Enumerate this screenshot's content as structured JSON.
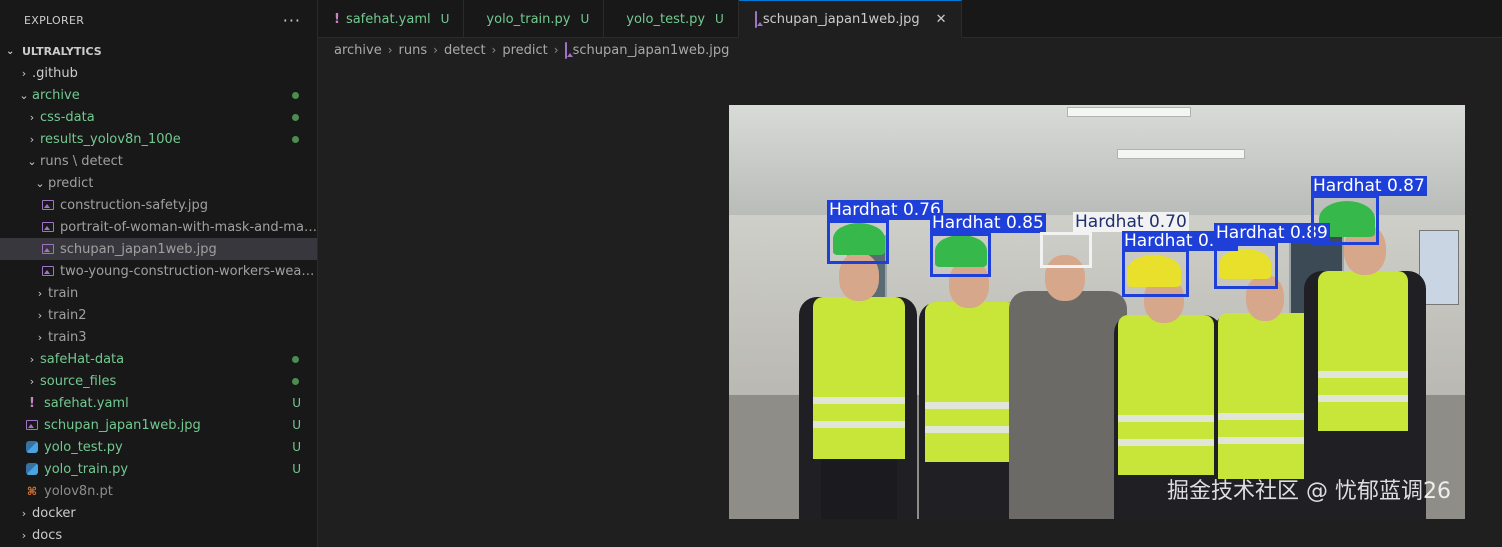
{
  "sidebar": {
    "title": "EXPLORER",
    "more": "···",
    "section": "ULTRALYTICS",
    "rows": [
      {
        "label": ".github",
        "chev": "›",
        "indent": 0,
        "color": "plain",
        "icon": "",
        "deco": ""
      },
      {
        "label": "archive",
        "chev": "⌄",
        "indent": 0,
        "color": "green",
        "icon": "",
        "deco": "dot"
      },
      {
        "label": "css-data",
        "chev": "›",
        "indent": 1,
        "color": "green",
        "icon": "",
        "deco": "dot"
      },
      {
        "label": "results_yolov8n_100e",
        "chev": "›",
        "indent": 1,
        "color": "green",
        "icon": "",
        "deco": "dot"
      },
      {
        "label": "runs \\ detect",
        "chev": "⌄",
        "indent": 1,
        "color": "dim",
        "icon": "",
        "deco": ""
      },
      {
        "label": "predict",
        "chev": "⌄",
        "indent": 2,
        "color": "dim",
        "icon": "",
        "deco": ""
      },
      {
        "label": "construction-safety.jpg",
        "chev": "",
        "indent": 3,
        "color": "dim",
        "icon": "image",
        "deco": ""
      },
      {
        "label": "portrait-of-woman-with-mask-and-man-w...",
        "chev": "",
        "indent": 3,
        "color": "dim",
        "icon": "image",
        "deco": ""
      },
      {
        "label": "schupan_japan1web.jpg",
        "chev": "",
        "indent": 3,
        "color": "dim",
        "icon": "image",
        "deco": "",
        "selected": true
      },
      {
        "label": "two-young-construction-workers-wearing-...",
        "chev": "",
        "indent": 3,
        "color": "dim",
        "icon": "image",
        "deco": ""
      },
      {
        "label": "train",
        "chev": "›",
        "indent": 2,
        "color": "dim",
        "icon": "",
        "deco": ""
      },
      {
        "label": "train2",
        "chev": "›",
        "indent": 2,
        "color": "dim",
        "icon": "",
        "deco": ""
      },
      {
        "label": "train3",
        "chev": "›",
        "indent": 2,
        "color": "dim",
        "icon": "",
        "deco": ""
      },
      {
        "label": "safeHat-data",
        "chev": "›",
        "indent": 1,
        "color": "green",
        "icon": "",
        "deco": "dot"
      },
      {
        "label": "source_files",
        "chev": "›",
        "indent": 1,
        "color": "green",
        "icon": "",
        "deco": "dot"
      },
      {
        "label": "safehat.yaml",
        "chev": "",
        "indent": 1,
        "color": "green",
        "icon": "yaml",
        "deco": "U"
      },
      {
        "label": "schupan_japan1web.jpg",
        "chev": "",
        "indent": 1,
        "color": "green",
        "icon": "image",
        "deco": "U"
      },
      {
        "label": "yolo_test.py",
        "chev": "",
        "indent": 1,
        "color": "green",
        "icon": "python",
        "deco": "U"
      },
      {
        "label": "yolo_train.py",
        "chev": "",
        "indent": 1,
        "color": "green",
        "icon": "python",
        "deco": "U"
      },
      {
        "label": "yolov8n.pt",
        "chev": "",
        "indent": 1,
        "color": "gray",
        "icon": "rss",
        "deco": ""
      },
      {
        "label": "docker",
        "chev": "›",
        "indent": 0,
        "color": "plain",
        "icon": "",
        "deco": ""
      },
      {
        "label": "docs",
        "chev": "›",
        "indent": 0,
        "color": "plain",
        "icon": "",
        "deco": ""
      }
    ]
  },
  "tabs": [
    {
      "label": "safehat.yaml",
      "icon": "yaml",
      "status": "U",
      "active": false,
      "color": "#73c991"
    },
    {
      "label": "yolo_train.py",
      "icon": "python",
      "status": "U",
      "active": false,
      "color": "#73c991"
    },
    {
      "label": "yolo_test.py",
      "icon": "python",
      "status": "U",
      "active": false,
      "color": "#73c991"
    },
    {
      "label": "schupan_japan1web.jpg",
      "icon": "image",
      "status": "",
      "active": true,
      "color": "#cccccc"
    }
  ],
  "breadcrumb": [
    "archive",
    "runs",
    "detect",
    "predict",
    "schupan_japan1web.jpg"
  ],
  "detections": [
    {
      "label": "Hardhat 0.76",
      "color": "blue"
    },
    {
      "label": "Hardhat 0.85",
      "color": "blue"
    },
    {
      "label": "Hardhat 0.70",
      "color": "white"
    },
    {
      "label": "Hardhat 0.87",
      "color": "blue"
    },
    {
      "label": "Hardhat 0.89",
      "color": "blue"
    },
    {
      "label": "Hardhat 0.87",
      "color": "blue"
    }
  ],
  "watermark": "掘金技术社区 @ 忧郁蓝调26",
  "colors": {
    "accent": "#0078d4",
    "untracked": "#73c991",
    "bbox": "#1f3fd9"
  }
}
